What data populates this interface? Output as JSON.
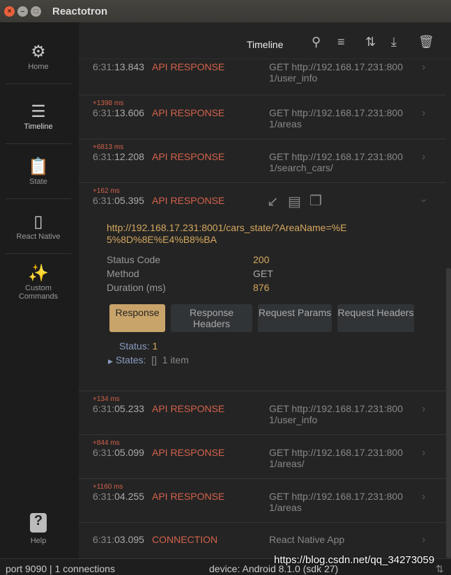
{
  "window": {
    "title": "Reactotron"
  },
  "sidebar": {
    "items": [
      {
        "label": "Home",
        "icon": "home-icon"
      },
      {
        "label": "Timeline",
        "icon": "timeline-icon"
      },
      {
        "label": "State",
        "icon": "clipboard-icon"
      },
      {
        "label": "React Native",
        "icon": "phone-icon"
      },
      {
        "label": "Custom Commands",
        "icon": "magic-wand-icon"
      }
    ],
    "help": "Help"
  },
  "header": {
    "title": "Timeline"
  },
  "rows": [
    {
      "delta": "",
      "time_prefix": "6:31:",
      "time": "13.843",
      "kind": "API RESPONSE",
      "summary": "GET http://192.168.17.231:8001/user_info"
    },
    {
      "delta": "+1398 ms",
      "time_prefix": "6:31:",
      "time": "13.606",
      "kind": "API RESPONSE",
      "summary": "GET http://192.168.17.231:8001/areas"
    },
    {
      "delta": "+6813 ms",
      "time_prefix": "6:31:",
      "time": "12.208",
      "kind": "API RESPONSE",
      "summary": "GET http://192.168.17.231:8001/search_cars/"
    },
    {
      "delta": "+162 ms",
      "time_prefix": "6:31:",
      "time": "05.395",
      "kind": "API RESPONSE",
      "summary": ""
    },
    {
      "delta": "+134 ms",
      "time_prefix": "6:31:",
      "time": "05.233",
      "kind": "API RESPONSE",
      "summary": "GET http://192.168.17.231:8001/user_info"
    },
    {
      "delta": "+844 ms",
      "time_prefix": "6:31:",
      "time": "05.099",
      "kind": "API RESPONSE",
      "summary": "GET http://192.168.17.231:8001/areas/"
    },
    {
      "delta": "+1160 ms",
      "time_prefix": "6:31:",
      "time": "04.255",
      "kind": "API RESPONSE",
      "summary": "GET http://192.168.17.231:8001/areas"
    },
    {
      "delta": "",
      "time_prefix": "6:31:",
      "time": "03.095",
      "kind": "CONNECTION",
      "summary": "React Native App"
    }
  ],
  "detail": {
    "url": "http://192.168.17.231:8001/cars_state/?AreaName=%E5%8D%8E%E4%B8%BA",
    "status_code_label": "Status Code",
    "status_code": "200",
    "method_label": "Method",
    "method": "GET",
    "duration_label": "Duration (ms)",
    "duration": "876",
    "tabs": [
      "Response",
      "Response Headers",
      "Request Params",
      "Request Headers"
    ],
    "tree": {
      "status_key": "Status:",
      "status_val": "1",
      "states_key": "States:",
      "states_bracket": "[]",
      "states_count": "1 item"
    }
  },
  "status": {
    "left": "port 9090 | 1 connections",
    "device": "device: Android 8.1.0 (sdk 27)"
  },
  "watermark": "https://blog.csdn.net/qq_34273059"
}
